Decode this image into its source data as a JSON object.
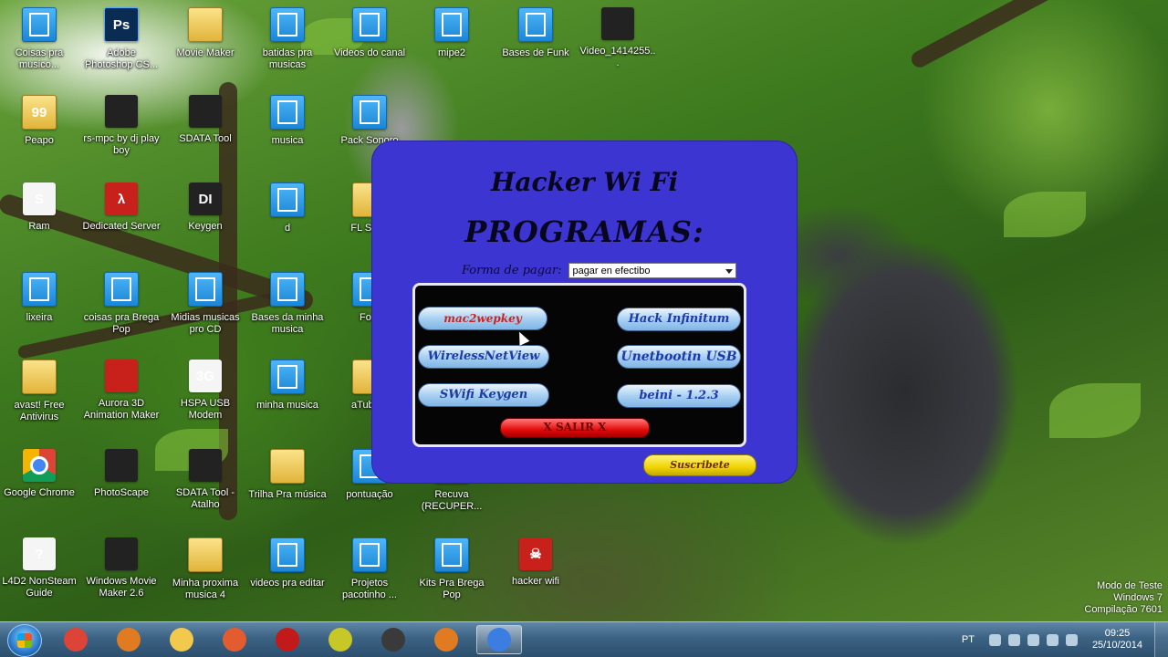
{
  "desktop_icons": [
    {
      "label": "Coisas pra musico...",
      "glyph": "",
      "style": "g-folder"
    },
    {
      "label": "Adobe Photoshop CS...",
      "glyph": "Ps",
      "style": "g-ps"
    },
    {
      "label": "Movie Maker",
      "glyph": "",
      "style": "g-yellow"
    },
    {
      "label": "batidas pra musicas",
      "glyph": "",
      "style": "g-folder"
    },
    {
      "label": "Videos do canal",
      "glyph": "",
      "style": "g-folder"
    },
    {
      "label": "mipe2",
      "glyph": "",
      "style": "g-folder"
    },
    {
      "label": "Bases de Funk",
      "glyph": "",
      "style": "g-folder"
    },
    {
      "label": "Video_1414255...",
      "glyph": "",
      "style": "g-dark"
    },
    {
      "label": "Peapo",
      "glyph": "99",
      "style": "g-yellow"
    },
    {
      "label": "rs-mpc by dj play boy",
      "glyph": "",
      "style": "g-dark"
    },
    {
      "label": "SDATA Tool",
      "glyph": "",
      "style": "g-dark"
    },
    {
      "label": "musica",
      "glyph": "",
      "style": "g-folder"
    },
    {
      "label": "Pack Sonoro",
      "glyph": "",
      "style": "g-folder"
    },
    {
      "label": "Ram",
      "glyph": "S",
      "style": "g-white"
    },
    {
      "label": "Dedicated Server",
      "glyph": "λ",
      "style": "g-red"
    },
    {
      "label": "Keygen",
      "glyph": "DI",
      "style": "g-dark"
    },
    {
      "label": "d",
      "glyph": "",
      "style": "g-folder"
    },
    {
      "label": "FL Stu...",
      "glyph": "",
      "style": "g-yellow"
    },
    {
      "label": "lixeira",
      "glyph": "",
      "style": "g-folder"
    },
    {
      "label": "coisas pra Brega Pop",
      "glyph": "",
      "style": "g-folder"
    },
    {
      "label": "Midias musicas pro CD",
      "glyph": "",
      "style": "g-folder"
    },
    {
      "label": "Bases da minha musica",
      "glyph": "",
      "style": "g-folder"
    },
    {
      "label": "Fo...",
      "glyph": "",
      "style": "g-folder"
    },
    {
      "label": "avast! Free Antivirus",
      "glyph": "",
      "style": "g-yellow"
    },
    {
      "label": "Aurora 3D Animation Maker",
      "glyph": "",
      "style": "g-red"
    },
    {
      "label": "HSPA USB Modem",
      "glyph": "3G",
      "style": "g-white"
    },
    {
      "label": "minha musica",
      "glyph": "",
      "style": "g-folder"
    },
    {
      "label": "aTube...",
      "glyph": "",
      "style": "g-yellow"
    },
    {
      "label": "Google Chrome",
      "glyph": "",
      "style": "g-chrome"
    },
    {
      "label": "PhotoScape",
      "glyph": "",
      "style": "g-dark"
    },
    {
      "label": "SDATA Tool - Atalho",
      "glyph": "",
      "style": "g-dark"
    },
    {
      "label": "Trilha Pra música",
      "glyph": "",
      "style": "g-yellow"
    },
    {
      "label": "pontuação",
      "glyph": "",
      "style": "g-folder"
    },
    {
      "label": "Recuva (RECUPER...",
      "glyph": "",
      "style": "g-yellow"
    },
    {
      "label": "L4D2 NonSteam Guide",
      "glyph": "?",
      "style": "g-white"
    },
    {
      "label": "Windows Movie Maker 2.6",
      "glyph": "",
      "style": "g-dark"
    },
    {
      "label": "Minha proxima musica 4",
      "glyph": "",
      "style": "g-yellow"
    },
    {
      "label": "videos pra editar",
      "glyph": "",
      "style": "g-folder"
    },
    {
      "label": "Projetos pacotinho ...",
      "glyph": "",
      "style": "g-folder"
    },
    {
      "label": "Kits Pra Brega Pop",
      "glyph": "",
      "style": "g-folder"
    },
    {
      "label": "hacker wifi",
      "glyph": "☠",
      "style": "g-red"
    }
  ],
  "app": {
    "title_line1": "Hacker Wi Fi",
    "title_line2": "PROGRAMAS:",
    "payment_label": "Forma de pagar:",
    "payment_value": "pagar en efectibo",
    "buttons_left": [
      "mac2wepkey",
      "WirelessNetView",
      "SWifi Keygen"
    ],
    "buttons_right": [
      "Hack Infinitum",
      "Unetbootin USB",
      "beini - 1.2.3"
    ],
    "exit_label": "X SALIR X",
    "subscribe_label": "Suscribete"
  },
  "watermark": {
    "line1": "Modo de Teste",
    "line2": "Windows 7",
    "line3": "Compilação 7601"
  },
  "taskbar": {
    "language": "PT",
    "time": "09:25",
    "date": "25/10/2014",
    "pinned": [
      {
        "name": "chrome-taskbar-icon",
        "color": "#db4437"
      },
      {
        "name": "fl-studio-taskbar-icon",
        "color": "#e07b22"
      },
      {
        "name": "explorer-taskbar-icon",
        "color": "#f2c94c"
      },
      {
        "name": "winamp-taskbar-icon",
        "color": "#e35c2f"
      },
      {
        "name": "media-taskbar-icon",
        "color": "#c21a1a"
      },
      {
        "name": "app-taskbar-icon",
        "color": "#c7c727"
      },
      {
        "name": "film-taskbar-icon",
        "color": "#3a3a3a"
      },
      {
        "name": "fl-studio2-taskbar-icon",
        "color": "#e07b22"
      },
      {
        "name": "hacker-app-taskbar-icon",
        "color": "#3b7de0"
      }
    ]
  }
}
